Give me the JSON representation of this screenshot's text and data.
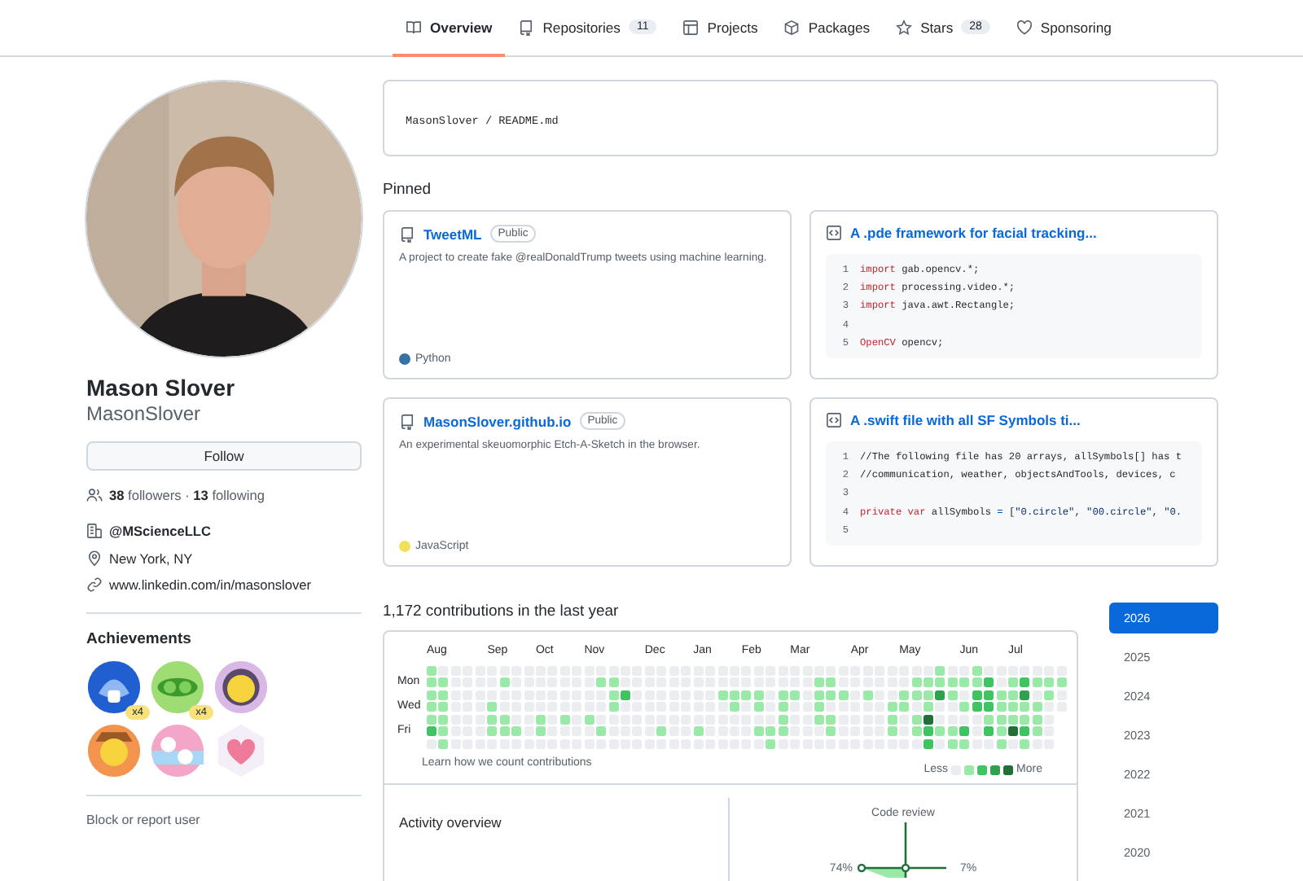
{
  "nav": {
    "tabs": [
      {
        "label": "Overview",
        "selected": true
      },
      {
        "label": "Repositories",
        "count": "11",
        "selected": false
      },
      {
        "label": "Projects",
        "selected": false
      },
      {
        "label": "Packages",
        "selected": false
      },
      {
        "label": "Stars",
        "count": "28",
        "selected": false
      },
      {
        "label": "Sponsoring",
        "selected": false
      }
    ]
  },
  "profile": {
    "name": "Mason Slover",
    "username": "MasonSlover",
    "follow_button": "Follow",
    "followers": "**38** followers · **13** following",
    "details": [
      {
        "kind": "organization",
        "text": "@MScienceLLC"
      },
      {
        "kind": "location",
        "text": "New York, NY"
      },
      {
        "kind": "link",
        "text": "www.linkedin.com/in/masonslover"
      }
    ],
    "achievements_title": "Achievements",
    "achievements": [
      {
        "kind": "shark",
        "count": "x4"
      },
      {
        "kind": "pea",
        "count": "x4"
      },
      {
        "kind": "star-face"
      },
      {
        "kind": "cowboy"
      },
      {
        "kind": "yolo"
      },
      {
        "kind": "heart"
      }
    ],
    "block_link": "Block or report user"
  },
  "readme": {
    "path": "MasonSlover / README.md"
  },
  "pinned_title": "Pinned",
  "pinned": [
    {
      "kind": "repository",
      "name": "TweetML",
      "visibility": "Public",
      "description": "A project to create fake @realDonaldTrump tweets using machine learning.",
      "language": "Python",
      "color": "#3572a5"
    },
    {
      "kind": "gist",
      "title": "A .pde framework for facial tracking...",
      "code": [
        {
          "number": "1",
          "tokens": [
            {
              "kind": "keyword",
              "text": "import"
            },
            {
              "kind": "plain",
              "text": " gab.opencv.*;"
            }
          ]
        },
        {
          "number": "2",
          "tokens": [
            {
              "kind": "keyword",
              "text": "import"
            },
            {
              "kind": "plain",
              "text": " processing.video.*;"
            }
          ]
        },
        {
          "number": "3",
          "tokens": [
            {
              "kind": "keyword",
              "text": "import"
            },
            {
              "kind": "plain",
              "text": " java.awt.Rectangle;"
            }
          ]
        },
        {
          "number": "4"
        },
        {
          "number": "5",
          "tokens": [
            {
              "kind": "type",
              "text": "OpenCV"
            },
            {
              "kind": "plain",
              "text": " opencv;"
            }
          ]
        }
      ]
    },
    {
      "kind": "repository",
      "name": "MasonSlover.github.io",
      "visibility": "Public",
      "description": "An experimental skeuomorphic Etch-A-Sketch in the browser.",
      "language": "JavaScript",
      "color": "#f1e05a"
    },
    {
      "kind": "gist",
      "title": "A .swift file with all SF Symbols ti...",
      "code": [
        {
          "number": "1",
          "tokens": [
            {
              "kind": "comment",
              "text": "//The following file has 20 arrays, allSymbols[] has t"
            }
          ]
        },
        {
          "number": "2",
          "tokens": [
            {
              "kind": "comment",
              "text": "//communication, weather, objectsAndTools, devices, c"
            }
          ]
        },
        {
          "number": "3"
        },
        {
          "number": "4",
          "tokens": [
            {
              "kind": "keyword",
              "text": "private"
            },
            {
              "kind": "keyword",
              "text": " var"
            },
            {
              "kind": "plain",
              "text": " allSymbols "
            },
            {
              "kind": "operator",
              "text": "="
            },
            {
              "kind": "plain",
              "text": " ["
            },
            {
              "kind": "string",
              "text": "\"0.circle\""
            },
            {
              "kind": "plain",
              "text": ", "
            },
            {
              "kind": "string",
              "text": "\"00.circle\""
            },
            {
              "kind": "plain",
              "text": ", "
            },
            {
              "kind": "string",
              "text": "\"0."
            }
          ]
        },
        {
          "number": "5"
        }
      ]
    }
  ],
  "contributions": {
    "title": "1,172 contributions in the last year",
    "months": [
      "Aug",
      "Sep",
      "Oct",
      "Nov",
      "Dec",
      "Jan",
      "Feb",
      "Mar",
      "Apr",
      "May",
      "Jun",
      "Jul"
    ],
    "day_labels": [
      "Mon",
      "Wed",
      "Fri"
    ],
    "footer_link": "Learn how we count contributions",
    "legend_less": "Less",
    "legend_more": "More"
  },
  "activity": {
    "title": "Activity overview",
    "code_review_label": "Code review",
    "commits_percent": "74%",
    "issues_percent": "7%"
  },
  "years": [
    {
      "label": "2026",
      "selected": true
    },
    {
      "label": "2025",
      "selected": false
    },
    {
      "label": "2024",
      "selected": false
    },
    {
      "label": "2023",
      "selected": false
    },
    {
      "label": "2022",
      "selected": false
    },
    {
      "label": "2021",
      "selected": false
    },
    {
      "label": "2020",
      "selected": false
    }
  ]
}
